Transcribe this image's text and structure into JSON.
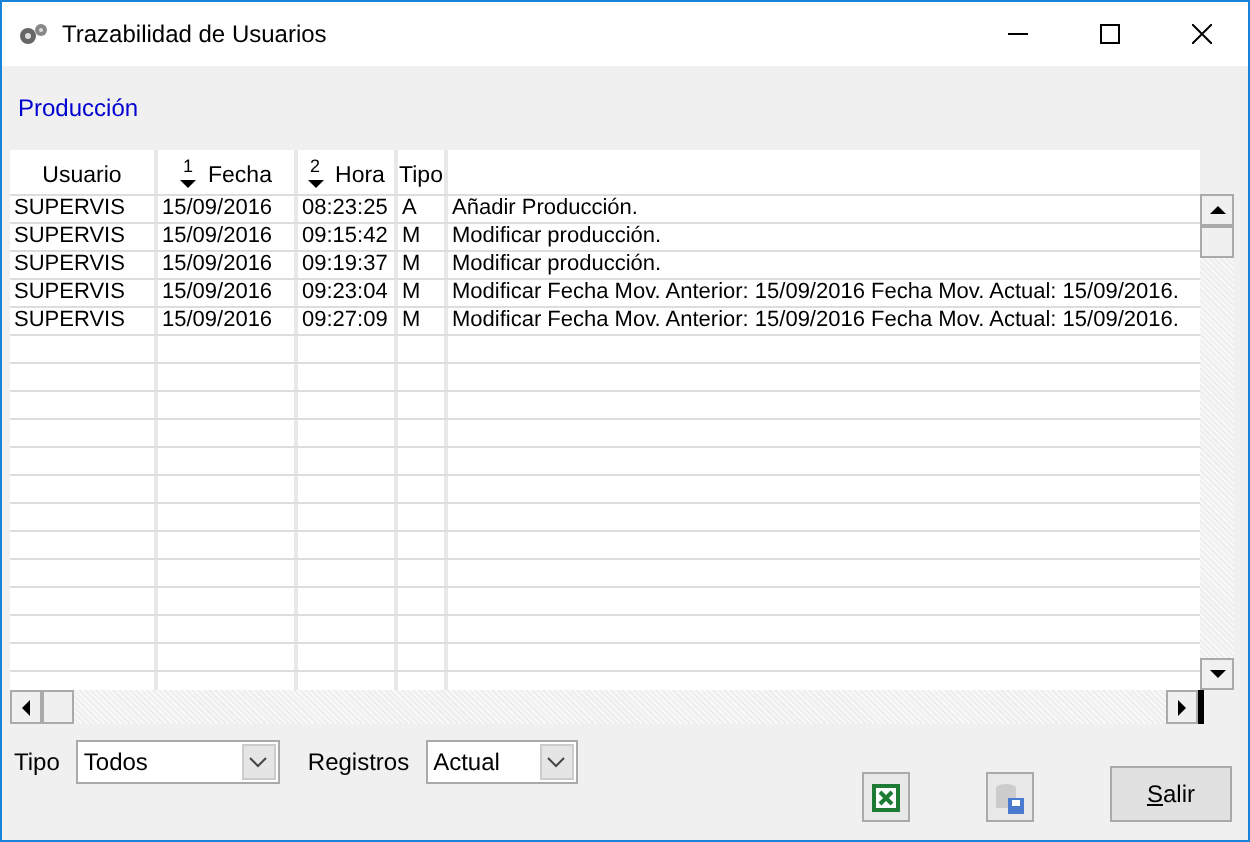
{
  "window": {
    "title": "Trazabilidad de Usuarios"
  },
  "link": "Producción",
  "table": {
    "columns": [
      {
        "label": "Usuario"
      },
      {
        "label": "Fecha",
        "sort_order": "1"
      },
      {
        "label": "Hora",
        "sort_order": "2"
      },
      {
        "label": "Tipo"
      }
    ],
    "rows": [
      {
        "cells": [
          "SUPERVIS",
          "15/09/2016",
          "08:23:25",
          "A",
          "Añadir Producción."
        ]
      },
      {
        "cells": [
          "SUPERVIS",
          "15/09/2016",
          "09:15:42",
          "M",
          "Modificar producción."
        ]
      },
      {
        "cells": [
          "SUPERVIS",
          "15/09/2016",
          "09:19:37",
          "M",
          "Modificar producción."
        ]
      },
      {
        "cells": [
          "SUPERVIS",
          "15/09/2016",
          "09:23:04",
          "M",
          "Modificar Fecha Mov. Anterior: 15/09/2016 Fecha Mov. Actual: 15/09/2016."
        ]
      },
      {
        "cells": [
          "SUPERVIS",
          "15/09/2016",
          "09:27:09",
          "M",
          "Modificar Fecha Mov. Anterior: 15/09/2016 Fecha Mov. Actual: 15/09/2016."
        ]
      }
    ]
  },
  "filters": [
    {
      "label": "Tipo",
      "value": "Todos"
    },
    {
      "label": "Registros",
      "value": "Actual"
    }
  ],
  "buttons": {
    "exit": "Salir"
  }
}
